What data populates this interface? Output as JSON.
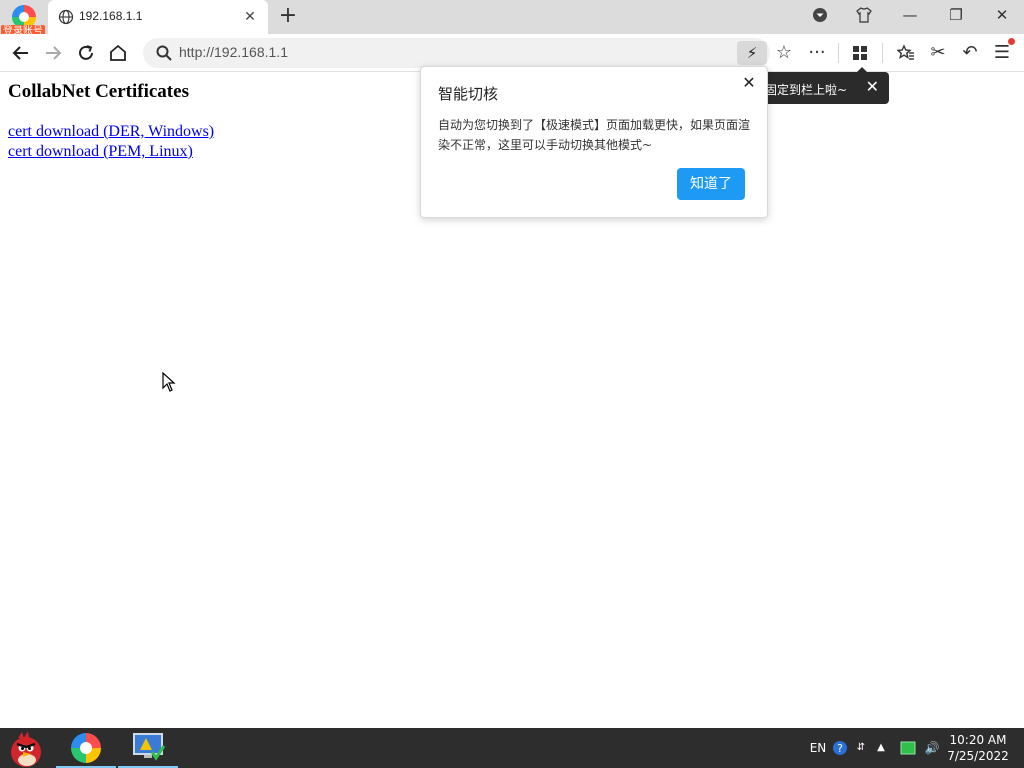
{
  "browser": {
    "profile_badge": "登录账号",
    "tab": {
      "title": "192.168.1.1"
    },
    "address": {
      "url": "http://192.168.1.1"
    }
  },
  "page": {
    "heading": "CollabNet Certificates",
    "links": [
      {
        "label": "cert download (DER, Windows)"
      },
      {
        "label": "cert download (PEM, Linux)"
      }
    ]
  },
  "tooltip": {
    "text": "固定到栏上啦~"
  },
  "popup": {
    "title": "智能切核",
    "body": "自动为您切换到了【极速模式】页面加载更快，如果页面渲染不正常，这里可以手动切换其他模式~",
    "button": "知道了"
  },
  "taskbar": {
    "lang": "EN",
    "time": "10:20 AM",
    "date": "7/25/2022"
  },
  "colors": {
    "accent_button": "#1e9af5",
    "link": "#0000ee",
    "taskbar": "#2d2d2d"
  }
}
